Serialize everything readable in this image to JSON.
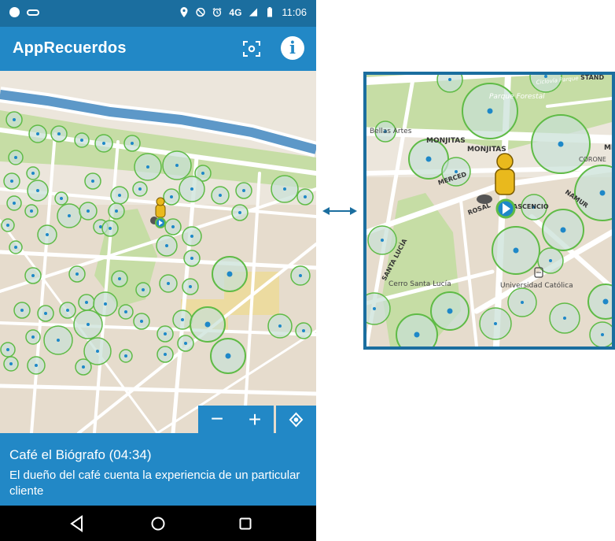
{
  "status_bar": {
    "network_label": "4G",
    "time": "11:06"
  },
  "app_bar": {
    "title": "AppRecuerdos",
    "scan_icon": "qr-scan-icon",
    "info_icon": "info-icon",
    "info_label": "i"
  },
  "map": {
    "zoom_out_label": "−",
    "zoom_in_label": "+",
    "locate_icon": "my-location-icon"
  },
  "info_panel": {
    "title": "Café el Biógrafo (04:34)",
    "description": "El dueño del café cuenta la experiencia de un particular cliente"
  },
  "nav_bar": {
    "back_icon": "back-triangle-icon",
    "home_icon": "home-circle-icon",
    "recents_icon": "recents-square-icon"
  },
  "zoom_map_labels": {
    "parque_forestal": "Parque Forestal",
    "ciclovia": "Ciclovía Parque Forestal",
    "stand_partial": "STAND",
    "bellas_artes": "Bellas Artes",
    "monjitas_1": "MONJITAS",
    "monjitas_2": "MONJITAS",
    "merced": "MERCED",
    "mi_partial": "MI",
    "corona_partial": "CORONE",
    "namur": "NAMUR",
    "rosal": "ROSAL",
    "ascencio": "ASCENCIO",
    "santa_lucia": "SANTA LUCÍA",
    "cerro_santa_lucia": "Cerro Santa Lucía",
    "universidad_catolica": "Universidad Católica"
  },
  "colors": {
    "app_bar": "#2288c6",
    "status_bar": "#1b6e9f",
    "poi_fill": "#c7dfd6",
    "poi_stroke": "#5fbb46",
    "poi_dot": "#1e88c8",
    "river": "#5d98c8",
    "park": "#c6dda5",
    "marker": "#e9b91d"
  }
}
